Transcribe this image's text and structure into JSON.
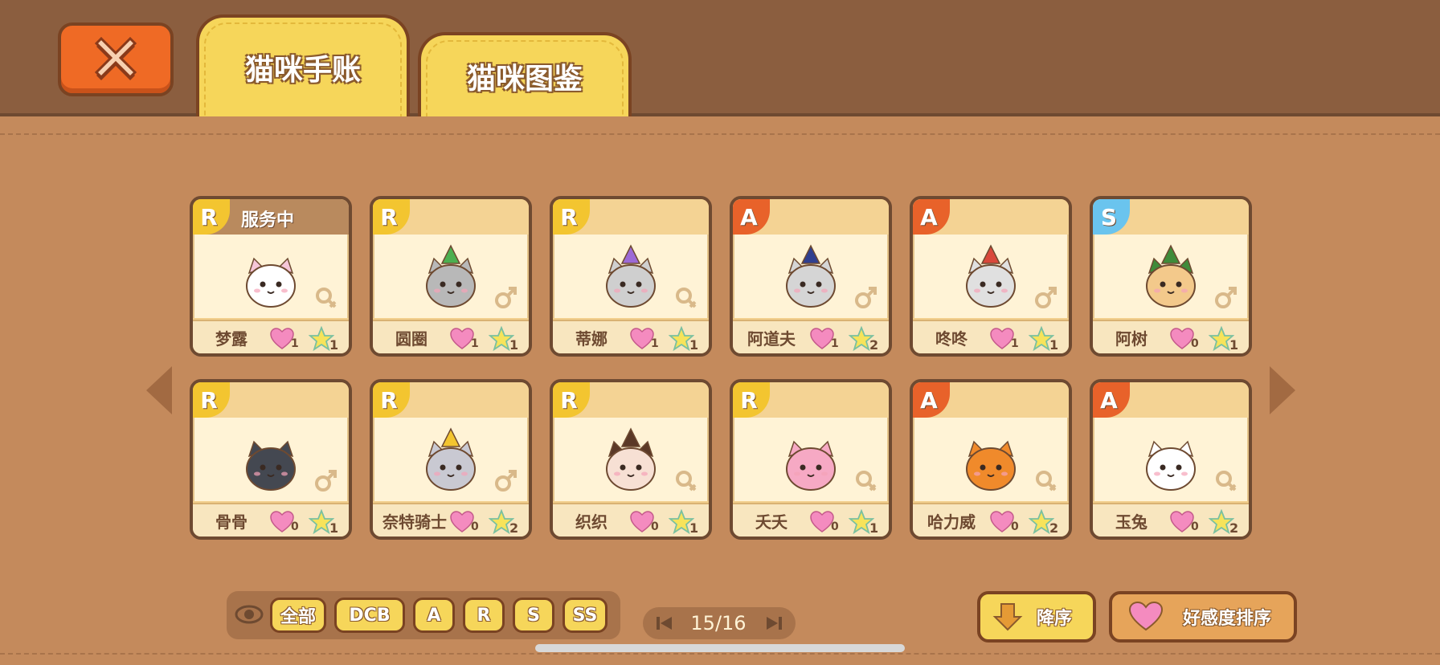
{
  "tabs": [
    {
      "label": "猫咪手账",
      "active": true
    },
    {
      "label": "猫咪图鉴",
      "active": false
    }
  ],
  "cards": [
    {
      "rank": "R",
      "status": "服务中",
      "name": "梦露",
      "hearts": "1",
      "stars": "1",
      "gender": "female",
      "cat": "white-cat"
    },
    {
      "rank": "R",
      "status": "",
      "name": "圆圈",
      "hearts": "1",
      "stars": "1",
      "gender": "male",
      "cat": "gray-cat-green-hat"
    },
    {
      "rank": "R",
      "status": "",
      "name": "蒂娜",
      "hearts": "1",
      "stars": "1",
      "gender": "female",
      "cat": "gray-cat-purple-hat"
    },
    {
      "rank": "A",
      "status": "",
      "name": "阿道夫",
      "hearts": "1",
      "stars": "2",
      "gender": "male",
      "cat": "gray-cat-navy-hat"
    },
    {
      "rank": "A",
      "status": "",
      "name": "咚咚",
      "hearts": "1",
      "stars": "1",
      "gender": "male",
      "cat": "gray-cat-red-hat"
    },
    {
      "rank": "S",
      "status": "",
      "name": "阿树",
      "hearts": "0",
      "stars": "1",
      "gender": "male",
      "cat": "tree-cat"
    },
    {
      "rank": "R",
      "status": "",
      "name": "骨骨",
      "hearts": "0",
      "stars": "1",
      "gender": "male",
      "cat": "skull-cat"
    },
    {
      "rank": "R",
      "status": "",
      "name": "奈特骑士",
      "hearts": "0",
      "stars": "2",
      "gender": "male",
      "cat": "knight-cat"
    },
    {
      "rank": "R",
      "status": "",
      "name": "织织",
      "hearts": "0",
      "stars": "1",
      "gender": "female",
      "cat": "weaver-cat"
    },
    {
      "rank": "R",
      "status": "",
      "name": "夭夭",
      "hearts": "0",
      "stars": "1",
      "gender": "female",
      "cat": "blossom-cat"
    },
    {
      "rank": "A",
      "status": "",
      "name": "哈力威",
      "hearts": "0",
      "stars": "2",
      "gender": "female",
      "cat": "pumpkin-cat"
    },
    {
      "rank": "A",
      "status": "",
      "name": "玉兔",
      "hearts": "0",
      "stars": "2",
      "gender": "female",
      "cat": "bunny-cat"
    }
  ],
  "filters": [
    "全部",
    "DCB",
    "A",
    "R",
    "S",
    "SS"
  ],
  "pager": {
    "text": "15/16"
  },
  "sort": {
    "desc_label": "降序",
    "fav_label": "好感度排序"
  },
  "colors": {
    "R": "#f3c530",
    "A": "#e8622a",
    "S": "#6ac4ee",
    "tab": "#f6d65a",
    "close": "#ef6a25"
  }
}
